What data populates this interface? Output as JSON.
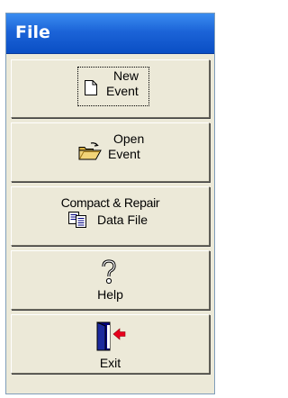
{
  "panel": {
    "title": "File"
  },
  "buttons": {
    "new_event": {
      "line1": "New",
      "line2": "Event",
      "icon": "new-document-icon"
    },
    "open_event": {
      "line1": "Open",
      "line2": "Event",
      "icon": "open-folder-icon"
    },
    "compact_repair": {
      "line1": "Compact & Repair",
      "line2": "Data File",
      "icon": "copy-documents-icon"
    },
    "help": {
      "label": "Help",
      "icon": "question-mark-icon"
    },
    "exit": {
      "label": "Exit",
      "icon": "exit-door-icon"
    }
  },
  "colors": {
    "title_bar": "#1c64d8",
    "panel_bg": "#ece9d8",
    "exit_arrow": "#e8001c"
  }
}
